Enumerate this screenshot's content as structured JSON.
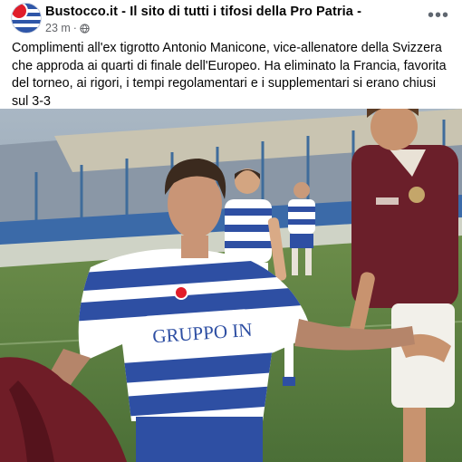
{
  "post": {
    "page_name": "Bustocco.it - Il sito di tutti i tifosi della Pro Patria -",
    "time": "23 m",
    "separator": "·",
    "audience_icon": "globe-icon",
    "more_icon": "more-horizontal-icon",
    "text": "Complimenti all'ex tigrotto Antonio Manicone, vice-allenatore della Svizzera che approda ai quarti di finale dell'Europeo. Ha eliminato la Francia, favorita del torneo, ai rigori, i tempi regolamentari e i supplementari si erano chiusi sul 3-3",
    "photo": {
      "shirt_text": "GRUPPO IN"
    }
  },
  "colors": {
    "pitch_green": "#4f7a3e",
    "kit_blue": "#2e4fa3",
    "opponent_maroon": "#6b1f2a",
    "meta_gray": "#65676b"
  }
}
